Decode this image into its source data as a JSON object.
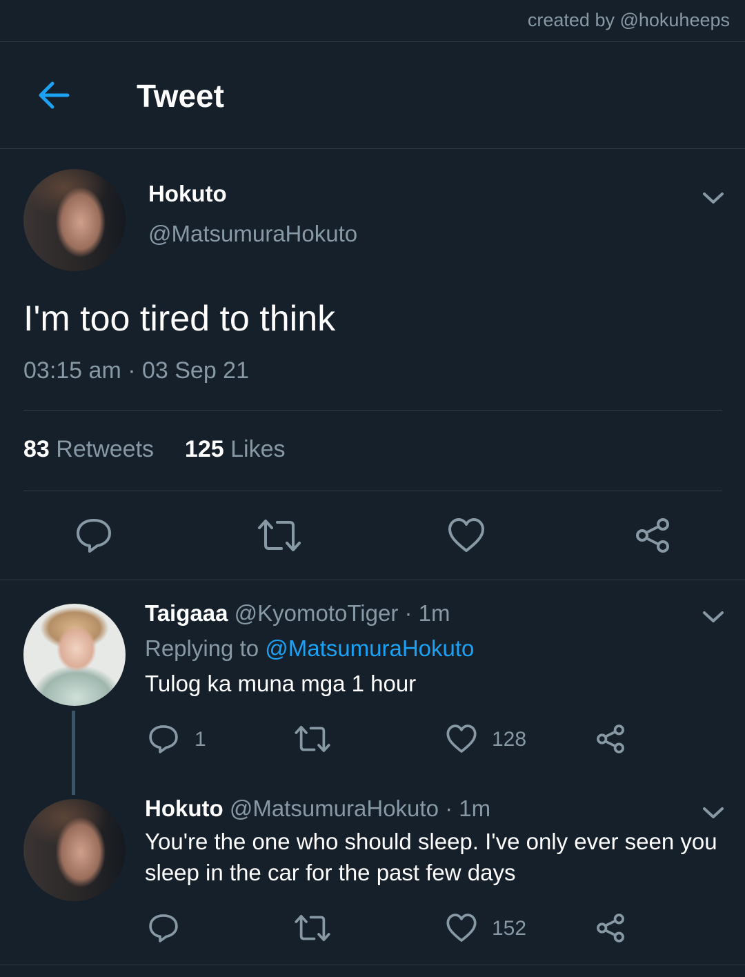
{
  "credit": "created by @hokuheeps",
  "header": {
    "title": "Tweet"
  },
  "tweet": {
    "name": "Hokuto",
    "handle": "@MatsumuraHokuto",
    "text": "I'm too tired to think",
    "timestamp": "03:15 am · 03 Sep 21",
    "retweets_count": "83",
    "retweets_label": "Retweets",
    "likes_count": "125",
    "likes_label": "Likes"
  },
  "replies": [
    {
      "name": "Taigaaa",
      "handle": "@KyomotoTiger",
      "time": "· 1m",
      "replying_prefix": "Replying to",
      "replying_to": "@MatsumuraHokuto",
      "text": "Tulog ka muna mga 1 hour",
      "reply_count": "1",
      "retweet_count": "",
      "like_count": "128"
    },
    {
      "name": "Hokuto",
      "handle": "@MatsumuraHokuto",
      "time": "· 1m",
      "text": "You're the one who should sleep. I've only ever seen you sleep in the car for the past few days",
      "reply_count": "",
      "retweet_count": "",
      "like_count": "152"
    }
  ],
  "colors": {
    "background": "#16202b",
    "accent": "#1da1f2",
    "muted": "#8899a6",
    "divider": "#2f3d4a"
  }
}
